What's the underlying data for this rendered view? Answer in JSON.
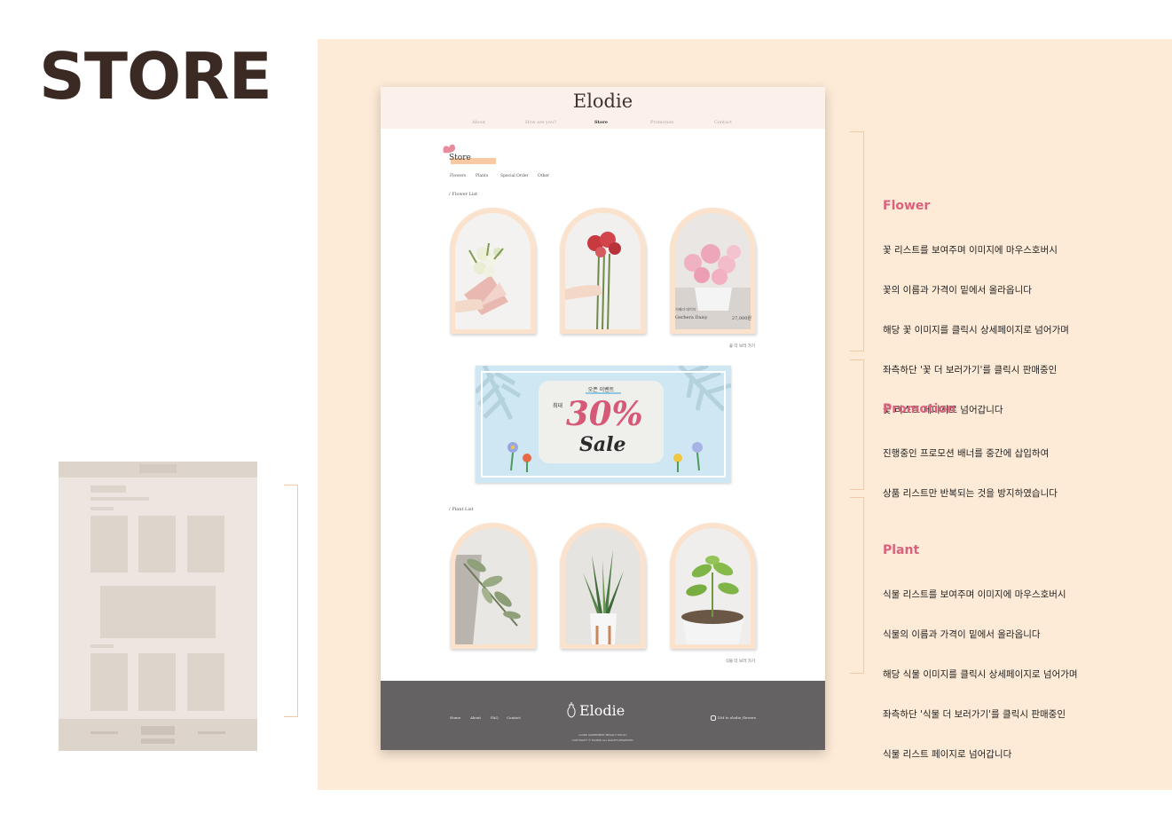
{
  "heading": "STORE",
  "mockup": {
    "logo": "Elodie",
    "nav": [
      {
        "label": "About",
        "active": false
      },
      {
        "label": "How are you?",
        "active": false
      },
      {
        "label": "Store",
        "active": true
      },
      {
        "label": "Promotion",
        "active": false
      },
      {
        "label": "Contact",
        "active": false
      }
    ],
    "store_title": "Store",
    "tabs": [
      "Flowers",
      "Plants",
      "Special Order",
      "Other"
    ],
    "flower_list_label": "/ Flower List",
    "flower_hover": {
      "name_kr": "거베라 데이지",
      "name_en": "Gerbera Daisy",
      "price": "27,000원"
    },
    "flower_more": "꽃 더 보러 가기",
    "banner": {
      "event": "오픈 이벤트",
      "max": "최대",
      "percent": "30%",
      "sale": "Sale"
    },
    "plant_list_label": "/ Plant List",
    "plant_more": "식물 더 보러 가기",
    "footer": {
      "links": [
        "Home",
        "About",
        "FAQ",
        "Contact"
      ],
      "logo": "Elodie",
      "dm": "DM to elodie_flowers",
      "policy_line1": "GUIDE AGREEMENT PRIVACY POLICY",
      "policy_line2": "COPYRIGHT © ELODIE ALL RIGHTS RESERVED."
    }
  },
  "annotations": [
    {
      "title": "Flower",
      "lines": [
        "꽃 리스트를 보여주며 이미지에 마우스호버시",
        "꽃의 이름과 가격이 밑에서 올라옵니다",
        "해당 꽃 이미지를 클릭시 상세페이지로 넘어가며",
        "좌측하단 '꽃 더 보러가기'를 클릭시 판매중인",
        "꽃 리스트 페이지로 넘어갑니다"
      ]
    },
    {
      "title": "Promotion",
      "lines": [
        "진행중인 프로모션 배너를 중간에 삽입하여",
        "상품 리스트만 반복되는 것을 방지하였습니다"
      ]
    },
    {
      "title": "Plant",
      "lines": [
        "식물 리스트를 보여주며 이미지에 마우스호버시",
        "식물의 이름과 가격이 밑에서 올라옵니다",
        "해당 식물 이미지를 클릭시 상세페이지로 넘어가며",
        "좌측하단 '식물 더 보러가기'를 클릭시 판매중인",
        "식물 리스트 페이지로 넘어갑니다"
      ]
    }
  ],
  "colors": {
    "accent": "#d9627c",
    "panel": "#fdebd7",
    "heading": "#3b2a24",
    "footer": "#646262"
  }
}
